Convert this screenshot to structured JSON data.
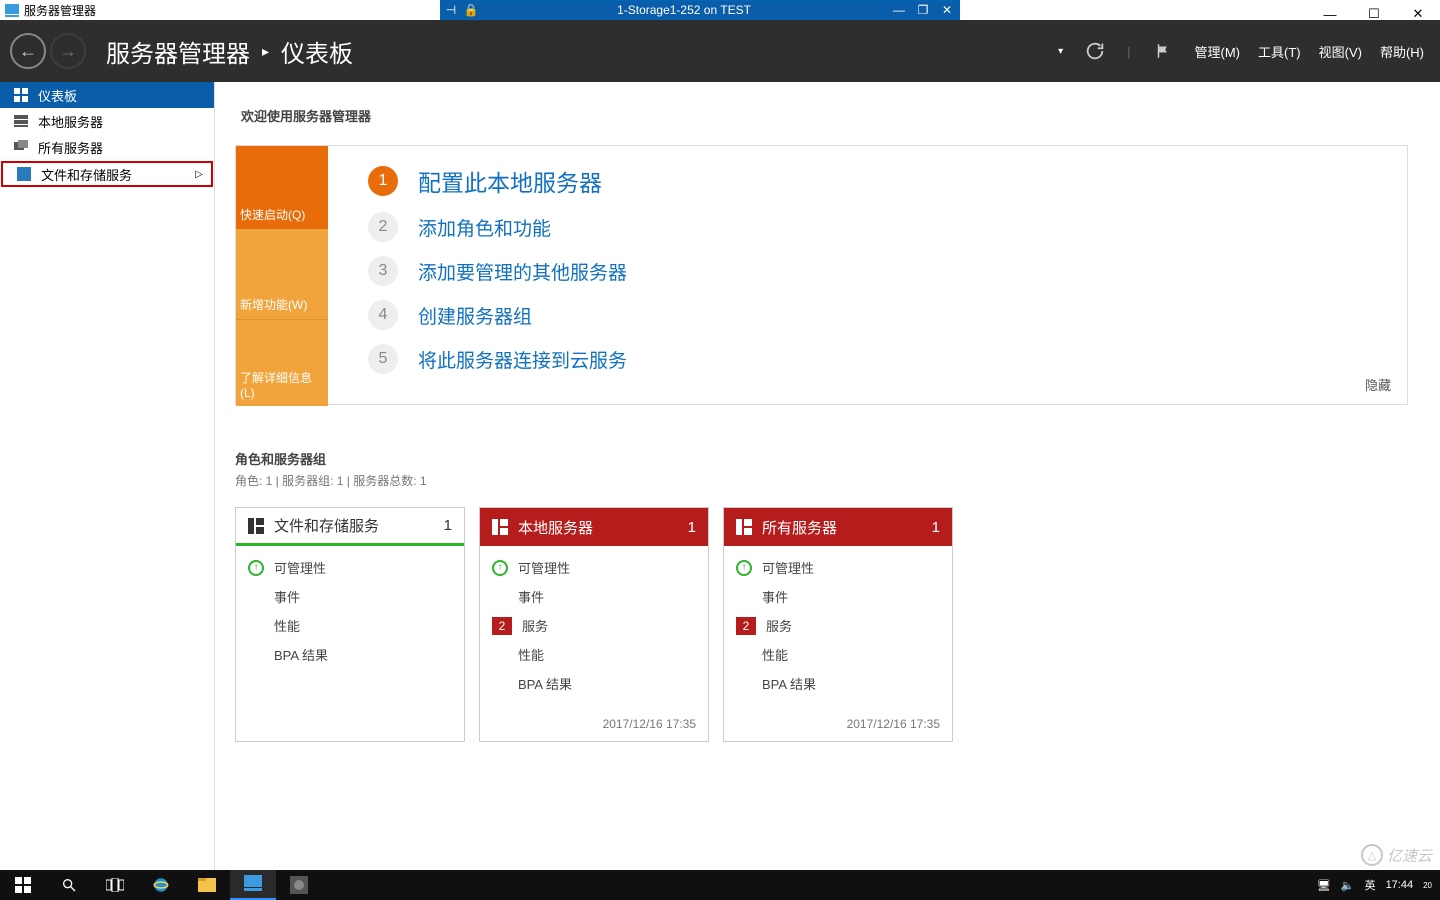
{
  "remote_session": {
    "title": "1-Storage1-252 on TEST"
  },
  "app": {
    "title": "服务器管理器"
  },
  "breadcrumb": {
    "root": "服务器管理器",
    "page": "仪表板"
  },
  "header_menus": {
    "manage": "管理(M)",
    "tools": "工具(T)",
    "view": "视图(V)",
    "help": "帮助(H)"
  },
  "sidebar": {
    "items": [
      {
        "label": "仪表板"
      },
      {
        "label": "本地服务器"
      },
      {
        "label": "所有服务器"
      },
      {
        "label": "文件和存储服务"
      }
    ]
  },
  "welcome": {
    "heading": "欢迎使用服务器管理器",
    "tabs": {
      "quickstart": "快速启动(Q)",
      "whatsnew": "新增功能(W)",
      "learnmore": "了解详细信息(L)"
    },
    "steps": [
      "配置此本地服务器",
      "添加角色和功能",
      "添加要管理的其他服务器",
      "创建服务器组",
      "将此服务器连接到云服务"
    ],
    "hide": "隐藏"
  },
  "roles": {
    "title": "角色和服务器组",
    "subtitle": "角色: 1 | 服务器组: 1 | 服务器总数: 1"
  },
  "tiles": [
    {
      "title": "文件和存储服务",
      "count": "1",
      "style": "green",
      "rows": [
        {
          "icon": "up",
          "label": "可管理性"
        },
        {
          "icon": "",
          "label": "事件"
        },
        {
          "icon": "",
          "label": "性能"
        },
        {
          "icon": "",
          "label": "BPA 结果"
        }
      ],
      "timestamp": ""
    },
    {
      "title": "本地服务器",
      "count": "1",
      "style": "red",
      "rows": [
        {
          "icon": "up",
          "label": "可管理性"
        },
        {
          "icon": "",
          "label": "事件"
        },
        {
          "icon": "badge",
          "badge": "2",
          "label": "服务"
        },
        {
          "icon": "",
          "label": "性能"
        },
        {
          "icon": "",
          "label": "BPA 结果"
        }
      ],
      "timestamp": "2017/12/16 17:35"
    },
    {
      "title": "所有服务器",
      "count": "1",
      "style": "red",
      "rows": [
        {
          "icon": "up",
          "label": "可管理性"
        },
        {
          "icon": "",
          "label": "事件"
        },
        {
          "icon": "badge",
          "badge": "2",
          "label": "服务"
        },
        {
          "icon": "",
          "label": "性能"
        },
        {
          "icon": "",
          "label": "BPA 结果"
        }
      ],
      "timestamp": "2017/12/16 17:35"
    }
  ],
  "tray": {
    "ime": "英",
    "time": "17:44",
    "date": "20"
  },
  "watermark": "亿速云"
}
